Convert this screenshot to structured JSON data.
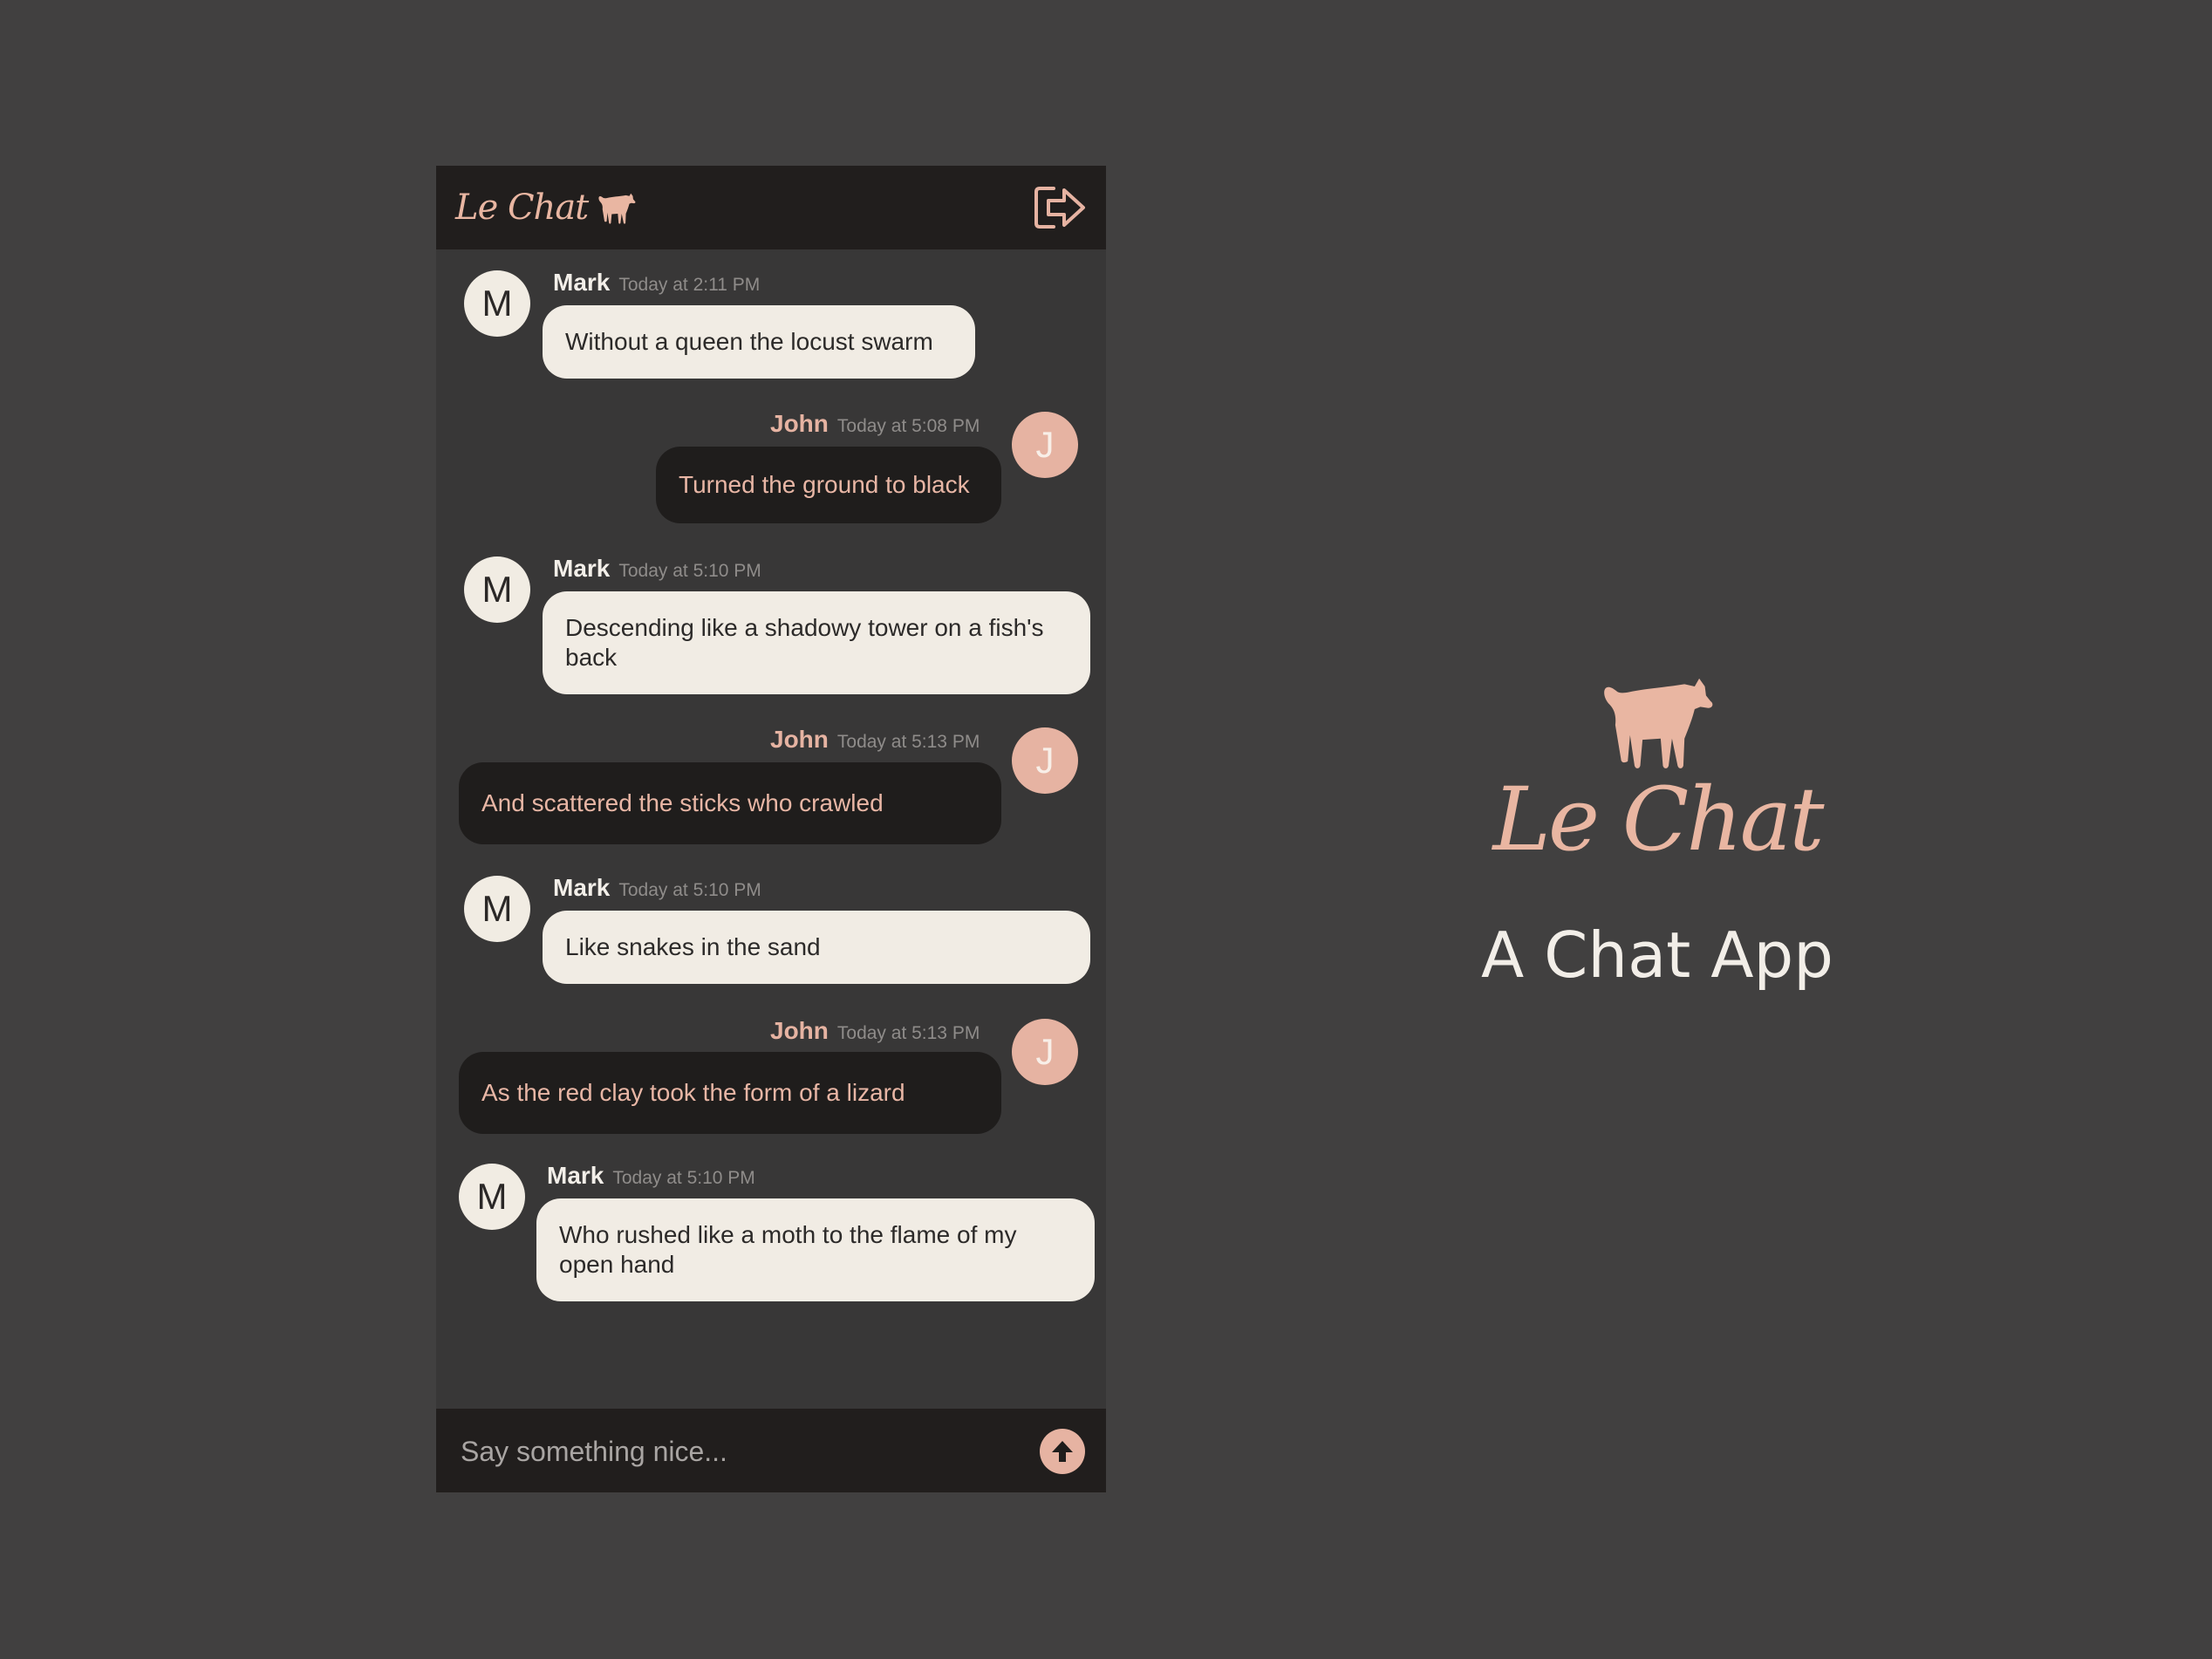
{
  "app": {
    "name": "Le Chat",
    "tagline": "A Chat App",
    "logo_icon": "cat-icon",
    "logout_icon": "logout-icon"
  },
  "colors": {
    "background": "#414040",
    "panel": "#383737",
    "bar": "#211e1d",
    "accent": "#e6b3a2",
    "light_bubble": "#f1ece4",
    "dark_bubble": "#1f1d1c"
  },
  "messages": [
    {
      "sender": "Mark",
      "initial": "M",
      "time": "Today at 2:11 PM",
      "text": "Without a queen the locust swarm"
    },
    {
      "sender": "John",
      "initial": "J",
      "time": "Today at 5:08 PM",
      "text": "Turned the ground to black"
    },
    {
      "sender": "Mark",
      "initial": "M",
      "time": "Today at 5:10 PM",
      "text": "Descending like a shadowy tower on a fish's back"
    },
    {
      "sender": "John",
      "initial": "J",
      "time": "Today at 5:13 PM",
      "text": "And scattered the sticks who crawled"
    },
    {
      "sender": "Mark",
      "initial": "M",
      "time": "Today at 5:10 PM",
      "text": "Like snakes in the sand"
    },
    {
      "sender": "John",
      "initial": "J",
      "time": "Today at 5:13 PM",
      "text": "As the red clay took the form of a lizard"
    },
    {
      "sender": "Mark",
      "initial": "M",
      "time": "Today at 5:10 PM",
      "text": "Who rushed like a moth to the flame of my open hand"
    }
  ],
  "composer": {
    "placeholder": "Say something nice...",
    "value": "",
    "send_icon": "arrow-up-icon"
  }
}
